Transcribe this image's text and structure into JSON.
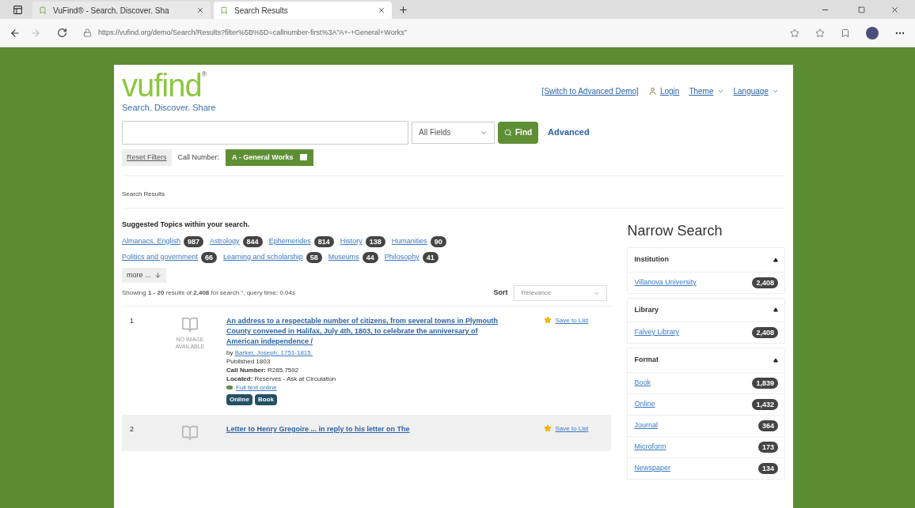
{
  "browser": {
    "tabs": [
      {
        "title": "VuFind® - Search. Discover. Sha",
        "selected": false
      },
      {
        "title": "Search Results",
        "selected": true
      }
    ],
    "url": "https://vufind.org/demo/Search/Results?filter%5B%5D=callnumber-first%3A\"A+-+General+Works\""
  },
  "header": {
    "logo": "vufind",
    "logo_mark": "®",
    "tagline": "Search. Discover. Share",
    "links": [
      {
        "label": "[Switch to Advanced Demo]",
        "kind": "plain"
      },
      {
        "label": "Login",
        "kind": "login"
      },
      {
        "label": "Theme",
        "kind": "menu"
      },
      {
        "label": "Language",
        "kind": "menu"
      }
    ]
  },
  "search": {
    "field_type": "All Fields",
    "find": "Find",
    "advanced": "Advanced"
  },
  "filters": {
    "reset": "Reset Filters",
    "label": "Call Number:",
    "chip": "A - General Works"
  },
  "breadcrumb": "Search Results",
  "topics": {
    "heading": "Suggested Topics within your search.",
    "items": [
      {
        "label": "Almanacs, English",
        "count": "987"
      },
      {
        "label": "Astrology",
        "count": "844"
      },
      {
        "label": "Ephemerides",
        "count": "814"
      },
      {
        "label": "History",
        "count": "138"
      },
      {
        "label": "Humanities",
        "count": "90"
      },
      {
        "label": "Politics and government",
        "count": "66"
      },
      {
        "label": "Learning and scholarship",
        "count": "58"
      },
      {
        "label": "Museums",
        "count": "44"
      },
      {
        "label": "Philosophy",
        "count": "41"
      }
    ],
    "more": "more ..."
  },
  "stats": "Showing **1 - 20** results of **2,408** for search \", query time: 0.04s",
  "sort": {
    "label": "Sort",
    "value": "Relevance"
  },
  "results": [
    {
      "number": "1",
      "no_image": "NO IMAGE AVAILABLE",
      "title": "An address to a respectable number of citizens, from several towns in Plymouth County convened in Halifax, July 4th, 1803, to celebrate the anniversary of American independence /",
      "by": "by",
      "author": "Barker, Joseph, 1751-1815.",
      "published": "Published 1803",
      "call_label": "Call Number:",
      "call_value": "R285.7592",
      "located_label": "Located:",
      "located_value": "Reserves - Ask at Circulation",
      "link": "Full text online",
      "formats": [
        "Online",
        "Book"
      ],
      "save": "Save to List"
    },
    {
      "number": "2",
      "title": "Letter to Henry Gregoire ... in reply to his letter on The",
      "save": "Save to List"
    }
  ],
  "facets": {
    "title": "Narrow Search",
    "groups": [
      {
        "title": "Institution",
        "expanded": true,
        "items": [
          {
            "label": "Villanova University",
            "count": "2,408"
          }
        ]
      },
      {
        "title": "Library",
        "expanded": true,
        "items": [
          {
            "label": "Falvey Library",
            "count": "2,408"
          }
        ]
      },
      {
        "title": "Format",
        "expanded": true,
        "items": [
          {
            "label": "Book",
            "count": "1,839"
          },
          {
            "label": "Online",
            "count": "1,432"
          },
          {
            "label": "Journal",
            "count": "364"
          },
          {
            "label": "Microform",
            "count": "173"
          },
          {
            "label": "Newspaper",
            "count": "134"
          }
        ]
      }
    ]
  }
}
